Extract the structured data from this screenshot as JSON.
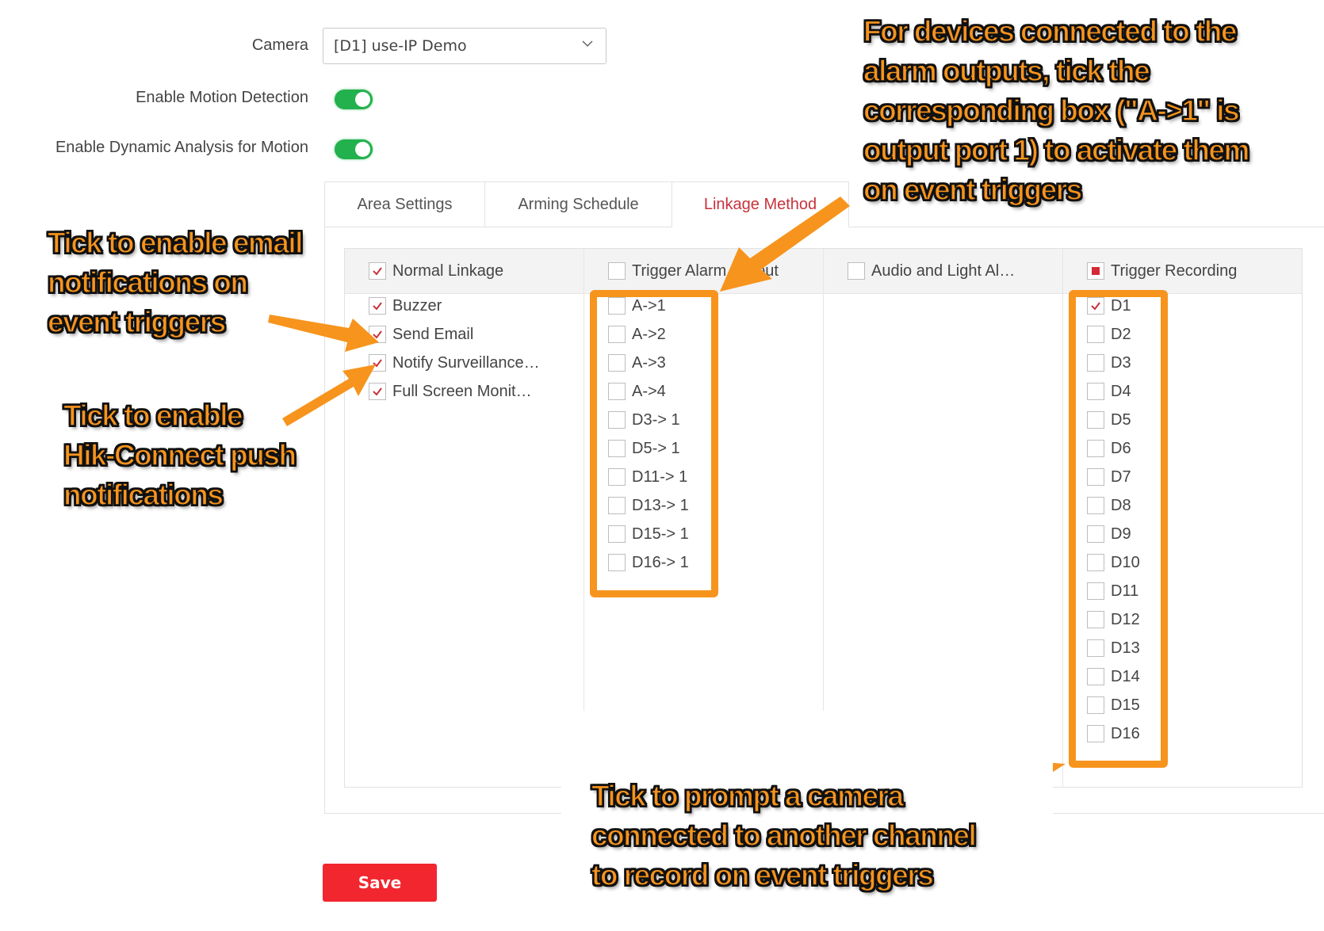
{
  "form": {
    "camera_label": "Camera",
    "camera_value": "[D1] use-IP Demo",
    "motion_label": "Enable Motion Detection",
    "motion_enabled": true,
    "dynamic_label": "Enable Dynamic Analysis for Motion",
    "dynamic_enabled": true
  },
  "tabs": [
    {
      "label": "Area Settings",
      "active": false
    },
    {
      "label": "Arming Schedule",
      "active": false
    },
    {
      "label": "Linkage Method",
      "active": true
    }
  ],
  "linkage": {
    "columns": [
      {
        "header": "Normal Linkage",
        "header_state": "checked",
        "items": [
          {
            "label": "Buzzer",
            "checked": true
          },
          {
            "label": "Send Email",
            "checked": true
          },
          {
            "label": "Notify Surveillance…",
            "checked": true
          },
          {
            "label": "Full Screen Monit…",
            "checked": true
          }
        ]
      },
      {
        "header": "Trigger Alarm Output",
        "header_state": "unchecked",
        "items": [
          {
            "label": "A->1",
            "checked": false
          },
          {
            "label": "A->2",
            "checked": false
          },
          {
            "label": "A->3",
            "checked": false
          },
          {
            "label": "A->4",
            "checked": false
          },
          {
            "label": "D3-> 1",
            "checked": false
          },
          {
            "label": "D5-> 1",
            "checked": false
          },
          {
            "label": "D11-> 1",
            "checked": false
          },
          {
            "label": "D13-> 1",
            "checked": false
          },
          {
            "label": "D15-> 1",
            "checked": false
          },
          {
            "label": "D16-> 1",
            "checked": false
          }
        ]
      },
      {
        "header": "Audio and Light Al…",
        "header_state": "unchecked",
        "items": []
      },
      {
        "header": "Trigger Recording",
        "header_state": "partial",
        "items": [
          {
            "label": "D1",
            "checked": true
          },
          {
            "label": "D2",
            "checked": false
          },
          {
            "label": "D3",
            "checked": false
          },
          {
            "label": "D4",
            "checked": false
          },
          {
            "label": "D5",
            "checked": false
          },
          {
            "label": "D6",
            "checked": false
          },
          {
            "label": "D7",
            "checked": false
          },
          {
            "label": "D8",
            "checked": false
          },
          {
            "label": "D9",
            "checked": false
          },
          {
            "label": "D10",
            "checked": false
          },
          {
            "label": "D11",
            "checked": false
          },
          {
            "label": "D12",
            "checked": false
          },
          {
            "label": "D13",
            "checked": false
          },
          {
            "label": "D14",
            "checked": false
          },
          {
            "label": "D15",
            "checked": false
          },
          {
            "label": "D16",
            "checked": false
          }
        ]
      }
    ]
  },
  "save_label": "Save",
  "annotations": {
    "email": [
      "Tick to enable email",
      "notifications on",
      "event triggers"
    ],
    "push": [
      "Tick to enable",
      "Hik-Connect push",
      "notifications"
    ],
    "alarm_outputs": [
      "For devices connected to the",
      "alarm outputs, tick the",
      "corresponding box (\"A->1\" is",
      "output port 1) to activate them",
      "on event triggers"
    ],
    "recording": [
      "Tick to prompt a camera",
      "connected to another channel",
      "to record on event triggers"
    ]
  },
  "colors": {
    "accent": "#c8323c",
    "toggle_on": "#22b14c",
    "save_button": "#f2262e",
    "annotation": "#f7941d"
  }
}
